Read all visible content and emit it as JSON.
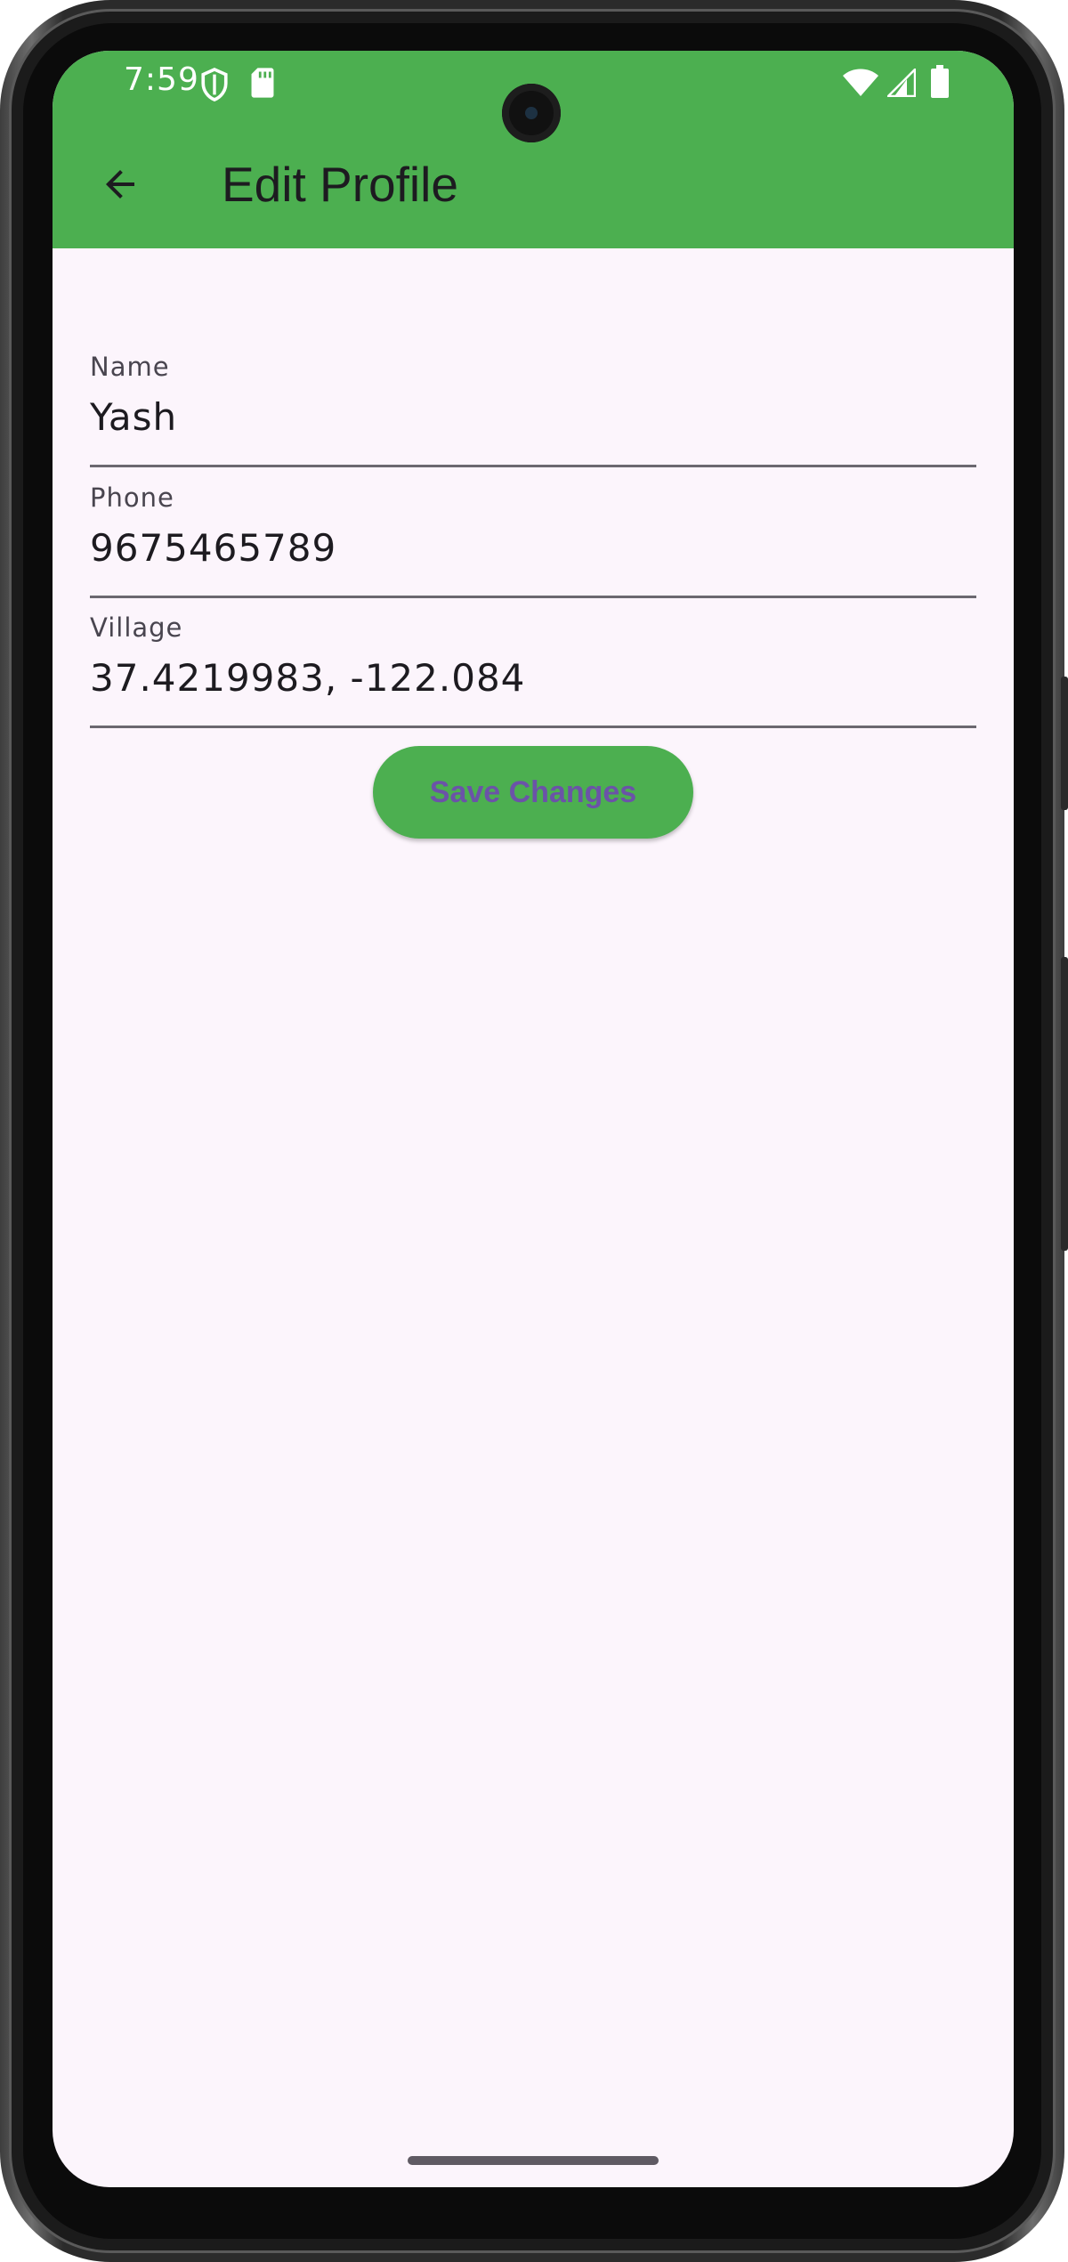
{
  "status_bar": {
    "time": "7:59",
    "left_icons": [
      "shield-icon",
      "sd-card-icon"
    ],
    "right_icons": [
      "wifi-icon",
      "cell-signal-icon",
      "battery-icon"
    ]
  },
  "app_bar": {
    "title": "Edit Profile",
    "back_icon": "arrow-back-icon",
    "color": "#4caf50"
  },
  "form": {
    "fields": [
      {
        "label": "Name",
        "value": "Yash"
      },
      {
        "label": "Phone",
        "value": "9675465789"
      },
      {
        "label": "Village",
        "value": "37.4219983, -122.084"
      }
    ],
    "save_label": "Save Changes"
  },
  "colors": {
    "accent": "#4caf50",
    "button_text": "#6b53a8",
    "background": "#fcf5fc"
  }
}
